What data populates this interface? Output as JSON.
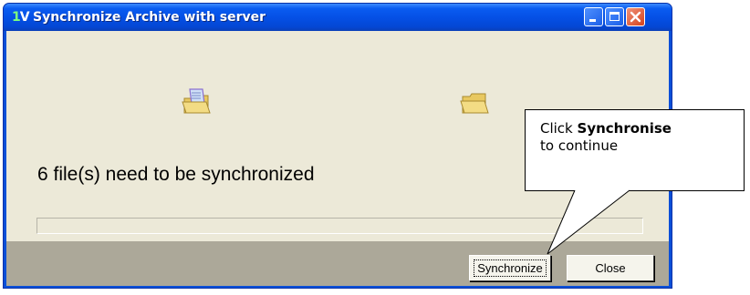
{
  "window": {
    "title": "Synchronize Archive with server",
    "icon_text": "1V"
  },
  "main": {
    "status_text": "6 file(s) need to be synchronized",
    "progress_fraction": 0
  },
  "buttons": {
    "synchronize_label": "Synchronize",
    "close_label": "Close"
  },
  "callout": {
    "text_before": "Click ",
    "text_bold": "Synchronise",
    "text_after": "to continue"
  },
  "icons": {
    "source": "sync-folder-icon",
    "target": "folder-icon",
    "titlebar": [
      "minimize-icon",
      "maximize-icon",
      "close-icon"
    ]
  },
  "colors": {
    "titlebar": "#0a5cf0",
    "client_bg": "#ece9d8",
    "bottom_bar": "#aca899"
  }
}
